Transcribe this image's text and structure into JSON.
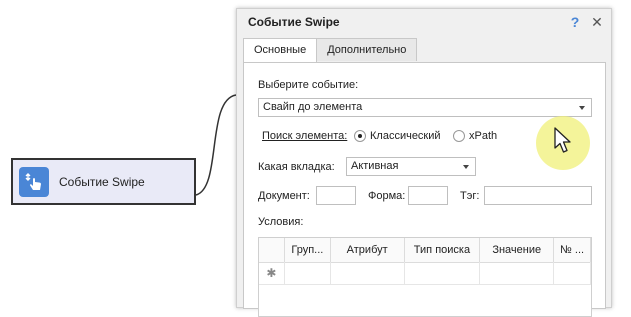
{
  "node": {
    "label": "Событие Swipe",
    "icon": "touch-swipe-icon"
  },
  "dialog": {
    "title": "Событие Swipe",
    "help_label": "?",
    "close_label": "✕",
    "tabs": [
      {
        "label": "Основные"
      },
      {
        "label": "Дополнительно"
      }
    ],
    "event_label": "Выберите событие:",
    "event_value": "Свайп до элемента",
    "search_label": "Поиск элемента:",
    "radio_classic": "Классический",
    "radio_xpath": "xPath",
    "tab_label": "Какая вкладка:",
    "tab_value": "Активная",
    "doc_label": "Документ:",
    "form_label": "Форма:",
    "tag_label": "Тэг:",
    "conditions_label": "Условия:",
    "columns": [
      "",
      "Груп...",
      "Атрибут",
      "Тип поиска",
      "Значение",
      "№ ..."
    ],
    "new_row_marker": "✱"
  },
  "colors": {
    "accent": "#4a86d6",
    "node_bg": "#e9eaf7",
    "cursor_highlight": "#f0f078"
  }
}
